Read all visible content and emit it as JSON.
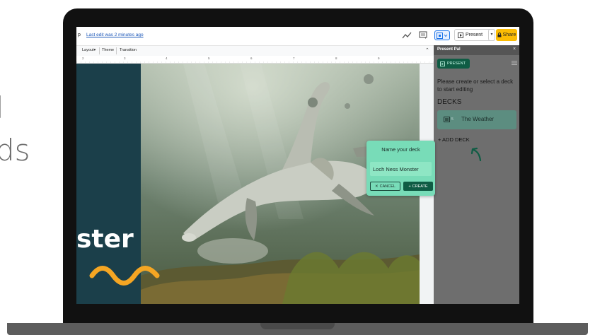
{
  "background_text": {
    "line1": "l",
    "line2": "ds"
  },
  "docs_topbar": {
    "menu_fragment": "p",
    "last_edit": "Last edit was 2 minutes ago",
    "present_label": "Present",
    "share_label": "Share"
  },
  "toolbar": {
    "items": [
      "Layout",
      "Theme",
      "Transition"
    ]
  },
  "ruler": {
    "numbers": [
      "2",
      "3",
      "4",
      "5",
      "6",
      "7",
      "8",
      "9"
    ]
  },
  "slide": {
    "title": "ster",
    "accent_color": "#f5a623",
    "bg_color": "#1b3f4a"
  },
  "panel": {
    "title": "Present Pal",
    "close_glyph": "×",
    "present_label": "PRESENT",
    "message": "Please create or select a deck to start editing",
    "decks_label": "DECKS",
    "decks": [
      {
        "count": "5",
        "name": "The Weather"
      }
    ],
    "add_deck_label": "+ ADD DECK",
    "accent_color": "#0f5c44"
  },
  "modal": {
    "title": "Name your deck",
    "input_value": "Loch Ness Monster",
    "cancel_label": "CANCEL",
    "create_label": "CREATE"
  }
}
